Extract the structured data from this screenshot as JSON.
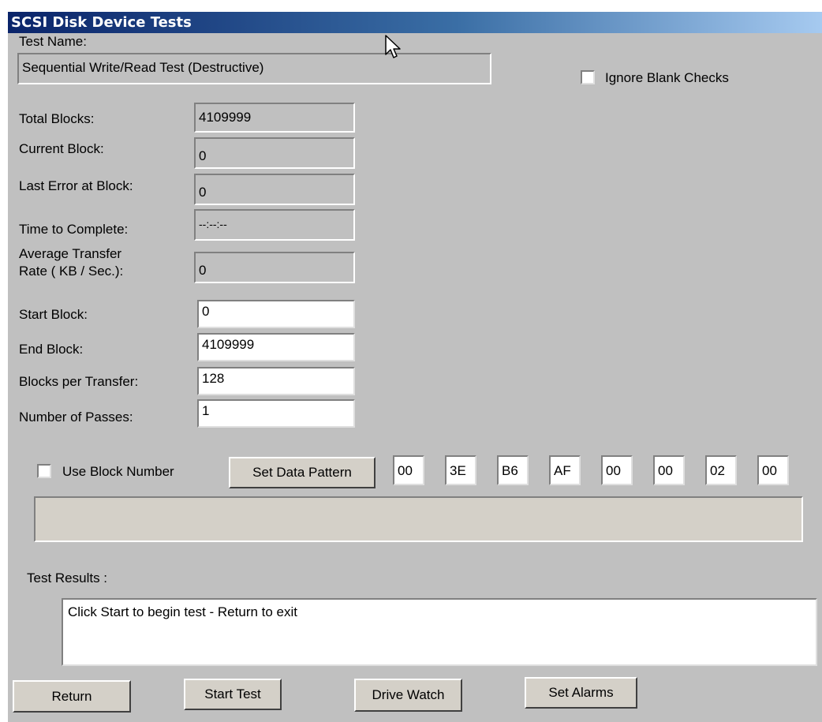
{
  "window": {
    "title": "SCSI Disk Device Tests"
  },
  "test_name": {
    "label": "Test Name:",
    "value": "Sequential Write/Read Test (Destructive)"
  },
  "ignore_blank_checks": {
    "label": "Ignore Blank Checks",
    "checked": false
  },
  "readonly_fields": [
    {
      "label": "Total Blocks:",
      "value": "4109999"
    },
    {
      "label": "Current Block:",
      "value": "0"
    },
    {
      "label": "Last Error at Block:",
      "value": "0"
    },
    {
      "label": "Time to Complete:",
      "value": "--:--:--"
    },
    {
      "label_line1": "Average Transfer",
      "label_line2": "Rate ( KB / Sec.):",
      "value": "0"
    }
  ],
  "editable_fields": [
    {
      "label": "Start Block:",
      "value": "0"
    },
    {
      "label": "End Block:",
      "value": "4109999"
    },
    {
      "label": "Blocks per Transfer:",
      "value": "128"
    },
    {
      "label": "Number of Passes:",
      "value": "1"
    }
  ],
  "use_block_number": {
    "label": "Use Block Number",
    "checked": false
  },
  "set_data_pattern_button": "Set Data Pattern",
  "data_pattern_bytes": [
    "00",
    "3E",
    "B6",
    "AF",
    "00",
    "00",
    "02",
    "00"
  ],
  "pattern_display": "",
  "test_results": {
    "label": "Test Results :",
    "text": "Click Start to begin test - Return to exit"
  },
  "buttons": {
    "return": "Return",
    "start_test": "Start Test",
    "drive_watch": "Drive Watch",
    "set_alarms": "Set Alarms"
  },
  "colors": {
    "title_bar_start": "#0a246a",
    "title_bar_end": "#a6caf0",
    "window_bg": "#c0c0c0",
    "button_face": "#d4d0c8"
  },
  "icons": {
    "mouse_pointer": "arrow-cursor-icon"
  }
}
